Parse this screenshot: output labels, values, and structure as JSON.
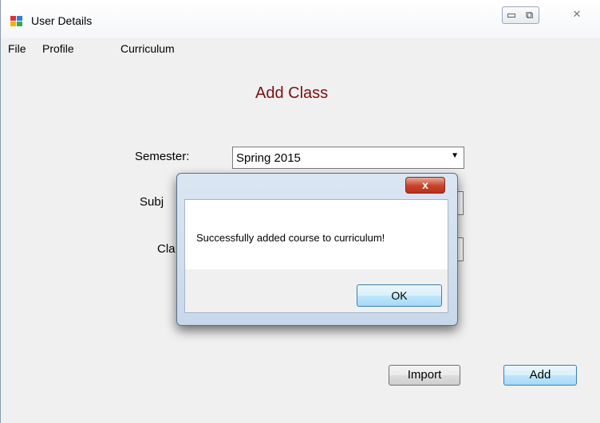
{
  "window": {
    "title": "User Details",
    "controls": {
      "minimize": "▭",
      "maximize": "⧉",
      "close": "✕"
    }
  },
  "menu": [
    "File",
    "Profile",
    "Curriculum"
  ],
  "form": {
    "heading": "Add Class",
    "semester_label": "Semester:",
    "semester_value": "Spring 2015",
    "subject_label_partial": "Subj",
    "class_label_partial": "Cla",
    "import_label": "Import",
    "add_label": "Add"
  },
  "dialog": {
    "close_label": "x",
    "message": "Successfully added course to curriculum!",
    "ok_label": "OK"
  },
  "colors": {
    "heading": "#7b0f0f",
    "accent_button": "#3c7fb1",
    "close_red": "#c7412b"
  }
}
